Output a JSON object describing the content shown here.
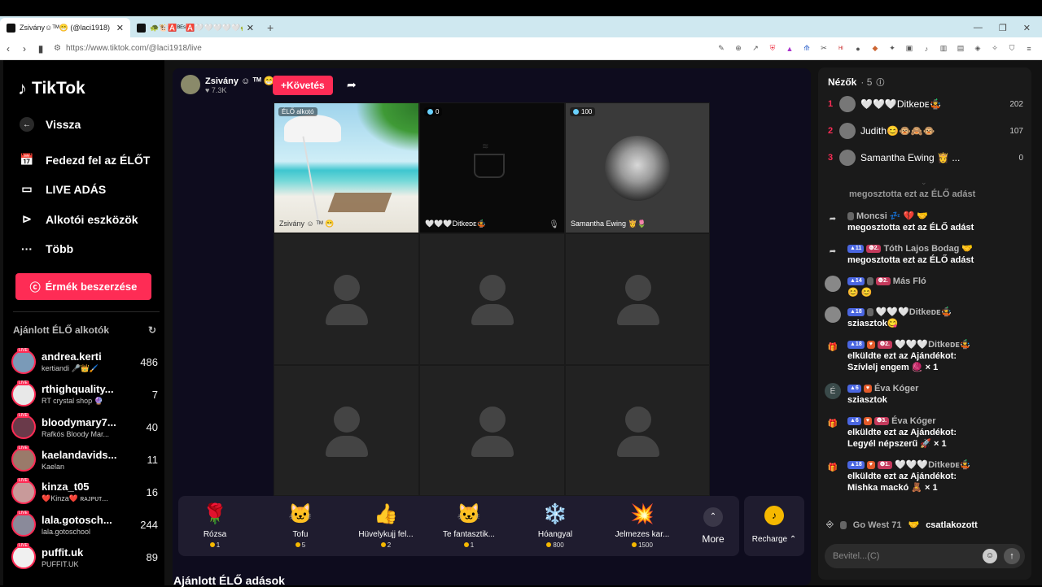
{
  "browser": {
    "tabs": [
      {
        "title": "Zsivány☺ᵀᴹ😁 (@laci1918) É...",
        "active": true
      },
      {
        "title": "🐢🐮🅰️ᴮᴱˢ🅰️🤍🤍🤍🤍🤍🐢 (@csby0...",
        "active": false
      }
    ],
    "new_tab": "+",
    "url": "https://www.tiktok.com/@laci1918/live"
  },
  "sidebar": {
    "logo": "TikTok",
    "back": "Vissza",
    "nav": [
      {
        "label": "Fedezd fel az ÉLŐT",
        "icon": "calendar-icon"
      },
      {
        "label": "LIVE ADÁS",
        "icon": "video-icon"
      },
      {
        "label": "Alkotói eszközök",
        "icon": "play-icon"
      },
      {
        "label": "Több",
        "icon": "more-icon"
      }
    ],
    "coin_button": "Érmék beszerzése",
    "recommended_title": "Ajánlott ÉLŐ alkotók",
    "creators": [
      {
        "name": "andrea.kerti",
        "sub": "kertiandi 🎤👑🖌️",
        "count": "486",
        "color": "#7a9ab8"
      },
      {
        "name": "rthighquality...",
        "sub": "RT crystal shop 🔮",
        "count": "7",
        "color": "#e8e8e8"
      },
      {
        "name": "bloodymary7...",
        "sub": "Rafkós Bloody Mar...",
        "count": "40",
        "color": "#6a3a4a"
      },
      {
        "name": "kaelandavids...",
        "sub": "Kaelan",
        "count": "11",
        "color": "#9a7a6a"
      },
      {
        "name": "kinza_t05",
        "sub": "❤️Kinza❤️ ʀᴀᴊᴘᴜᴛ...",
        "count": "16",
        "color": "#c89a9a"
      },
      {
        "name": "lala.gotosch...",
        "sub": "lala.gotoschool",
        "count": "244",
        "color": "#8a8a9a"
      },
      {
        "name": "puffit.uk",
        "sub": "PUFFIT.UK",
        "count": "89",
        "color": "#f0f0f0"
      }
    ]
  },
  "stream": {
    "host_name": "Zsivány",
    "host_badges": "☺ ᵀᴹ 😁",
    "likes": "7.3K",
    "follow": "Követés",
    "cells": [
      {
        "tag": "ÉLŐ alkotó",
        "name": "Zsivány ☺ ᵀᴹ 😁"
      },
      {
        "tag": "0",
        "name": "🤍🤍🤍Ditkeᴅᴇ🤹"
      },
      {
        "tag": "100",
        "name": "Samantha Ewing 👸🌷"
      }
    ],
    "gifts": [
      {
        "name": "Rózsa",
        "price": "1",
        "icon": "🌹"
      },
      {
        "name": "Tofu",
        "price": "5",
        "icon": "🐱"
      },
      {
        "name": "Hüvelykujj fel...",
        "price": "2",
        "icon": "👍"
      },
      {
        "name": "Te fantasztik...",
        "price": "1",
        "icon": "🐱"
      },
      {
        "name": "Hóangyal",
        "price": "800",
        "icon": "❄️"
      },
      {
        "name": "Jelmezes kar...",
        "price": "1500",
        "icon": "💥"
      }
    ],
    "more": "More",
    "recharge": "Recharge",
    "section_title": "Ajánlott ÉLŐ adások"
  },
  "chat": {
    "viewers_label": "Nézők",
    "viewers_count": "5",
    "viewers": [
      {
        "rank": "1",
        "name": "🤍🤍🤍Ditkeᴅᴇ🤹",
        "score": "202"
      },
      {
        "rank": "2",
        "name": "Judith😊🐵🙈🐵",
        "score": "107"
      },
      {
        "rank": "3",
        "name": "Samantha Ewing 👸 ...",
        "score": "0"
      }
    ],
    "partial_top": "megosztotta ezt az ÉLŐ adást",
    "messages": [
      {
        "icon": "share-icon",
        "user": "Moncsi",
        "badges": [
          "gray"
        ],
        "extra": "💤 💔 🤝",
        "text": "megosztotta ezt az ÉLŐ adást"
      },
      {
        "icon": "share-icon",
        "user": "Tóth Lajos Bodag",
        "badges": [
          "blue:11",
          "red:2."
        ],
        "extra": "🤝",
        "text": "megosztotta ezt az ÉLŐ adást"
      },
      {
        "icon": "avatar",
        "user": "Más Fló",
        "badges": [
          "blue:14",
          "gray",
          "red:2."
        ],
        "extra": "",
        "text": "😊 😊"
      },
      {
        "icon": "avatar",
        "user": "🤍🤍🤍Ditkeᴅᴇ🤹",
        "badges": [
          "blue:18",
          "gray"
        ],
        "extra": "",
        "text": "sziasztok😋"
      },
      {
        "icon": "gift-icon",
        "user": "🤍🤍🤍Ditkeᴅᴇ🤹",
        "badges": [
          "blue:18",
          "orange",
          "red:2."
        ],
        "extra": "",
        "text": "elküldte ezt az Ajándékot:",
        "text2": "Szívlelj engem 🧶 × 1"
      },
      {
        "icon": "letter-e-icon",
        "user": "Éva Kóger",
        "badges": [
          "blue:6",
          "orange"
        ],
        "extra": "",
        "text": "sziasztok"
      },
      {
        "icon": "gift-icon",
        "user": "Éva Kóger",
        "badges": [
          "blue:6",
          "orange",
          "red:3."
        ],
        "extra": "",
        "text": "elküldte ezt az Ajándékot:",
        "text2": "Legyél népszerű 🚀 × 1"
      },
      {
        "icon": "gift-icon",
        "user": "🤍🤍🤍Ditkeᴅᴇ🤹",
        "badges": [
          "blue:18",
          "orange",
          "red:1."
        ],
        "extra": "",
        "text": "elküldte ezt az Ajándékot:",
        "text2": "Mishka mackó 🧸 × 1"
      }
    ],
    "joined_user": "Go West 71",
    "joined_text": "csatlakozott",
    "input_placeholder": "Bevitel...(C)"
  }
}
